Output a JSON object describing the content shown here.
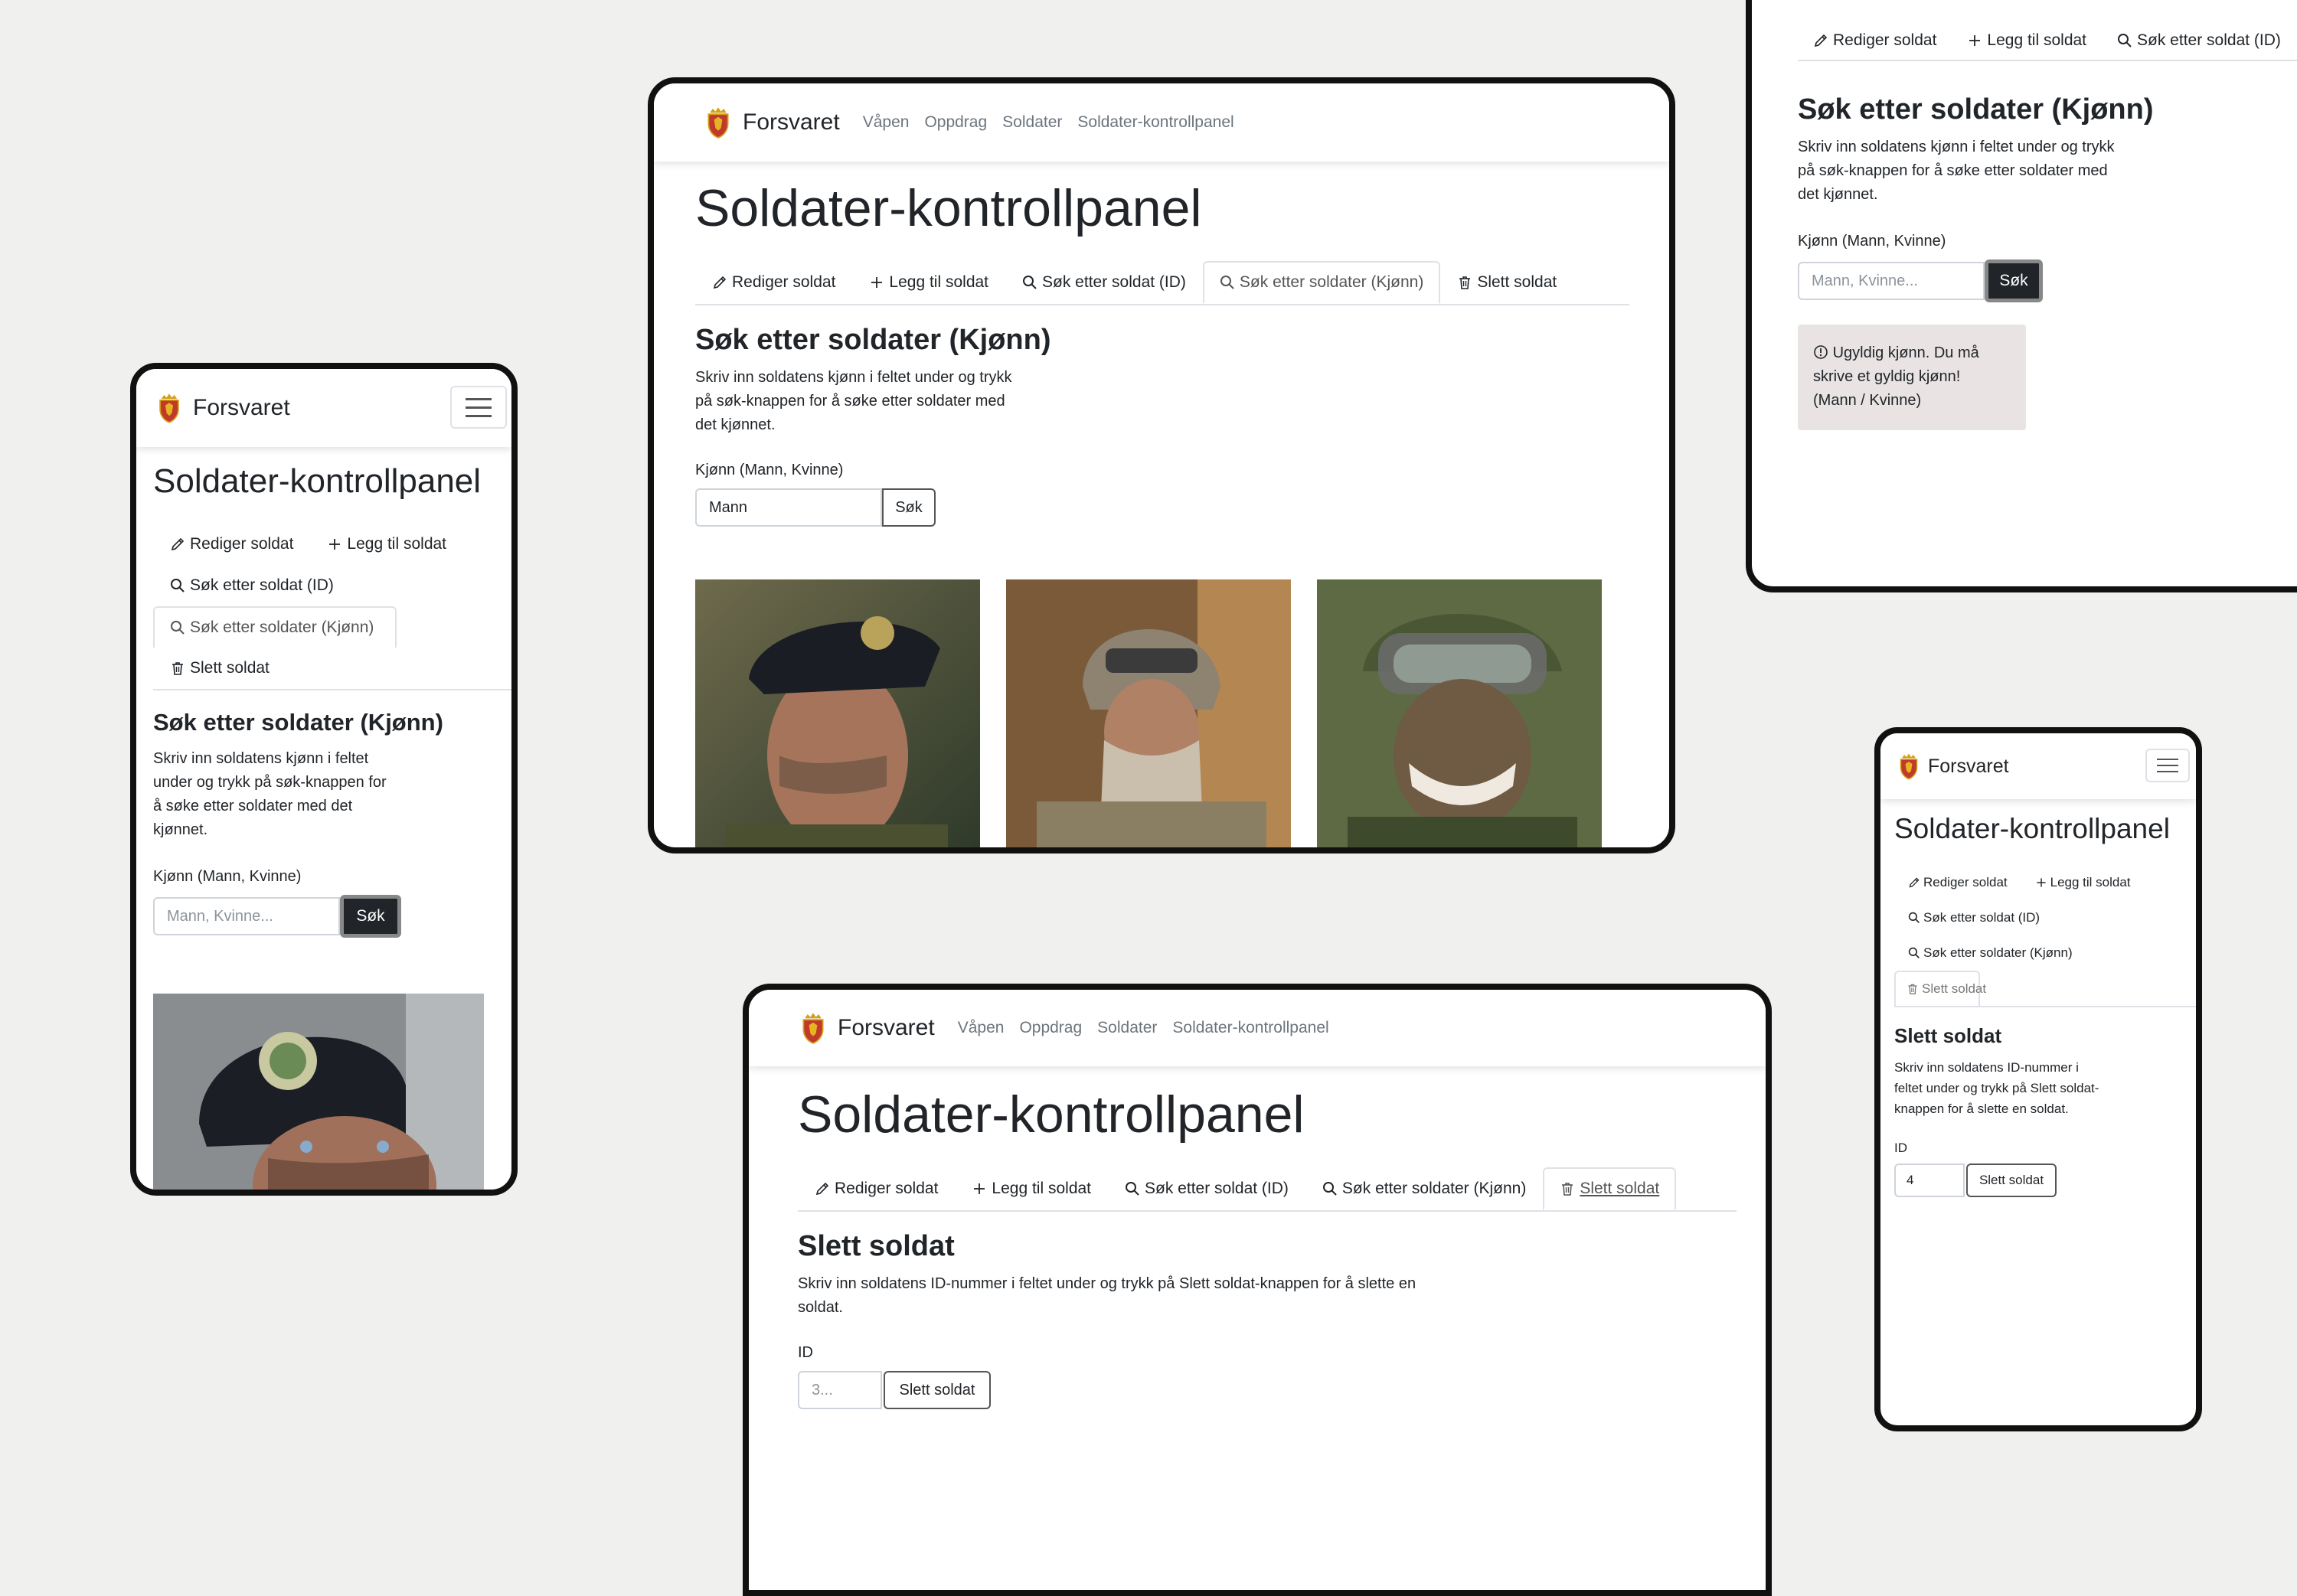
{
  "brand": {
    "name": "Forsvaret"
  },
  "nav": {
    "links": [
      "Våpen",
      "Oppdrag",
      "Soldater",
      "Soldater-kontrollpanel"
    ]
  },
  "page": {
    "title": "Soldater-kontrollpanel"
  },
  "tabs": {
    "edit": "Rediger soldat",
    "add": "Legg til soldat",
    "search_id": "Søk etter soldat (ID)",
    "search_gender": "Søk etter soldater (Kjønn)",
    "delete": "Slett soldat"
  },
  "search_gender": {
    "heading": "Søk etter soldater (Kjønn)",
    "description": "Skriv inn soldatens kjønn i feltet under og trykk på søk-knappen for å søke etter soldater med det kjønnet.",
    "desc_lines_wide": [
      "Skriv inn soldatens kjønn i feltet under og trykk",
      "på søk-knappen for å søke etter soldater med",
      "det kjønnet."
    ],
    "desc_lines_mobile": [
      "Skriv inn soldatens kjønn i feltet",
      "under og trykk på søk-knappen for",
      "å søke etter soldater med det",
      "kjønnet."
    ],
    "label": "Kjønn (Mann, Kvinne)",
    "value": "Mann",
    "placeholder": "Mann, Kvinne...",
    "button": "Søk",
    "error_lines": [
      "Ugyldig kjønn. Du må",
      "skrive et gyldig kjønn!",
      "(Mann / Kvinne)"
    ]
  },
  "delete": {
    "heading": "Slett soldat",
    "desc_lines_wide": [
      "Skriv inn soldatens ID-nummer i feltet under og trykk på Slett soldat-knappen for å slette en",
      "soldat."
    ],
    "desc_lines_narrow": [
      "Skriv inn soldatens ID-nummer i",
      "feltet under og trykk på Slett soldat-",
      "knappen for å slette en soldat."
    ],
    "label": "ID",
    "placeholder": "3...",
    "value": "4",
    "button": "Slett soldat"
  },
  "icons": {
    "edit": "pencil-icon",
    "add": "plus-icon",
    "search": "search-icon",
    "delete": "trash-icon",
    "menu": "hamburger-icon",
    "alert": "info-circle-icon",
    "crest": "royal-crest-logo"
  },
  "colors": {
    "background": "#f0f0ee",
    "frame": "#111111",
    "dark_button": "#212529",
    "nav_link": "#6c757d",
    "alert_bg": "#e9e3e3"
  }
}
